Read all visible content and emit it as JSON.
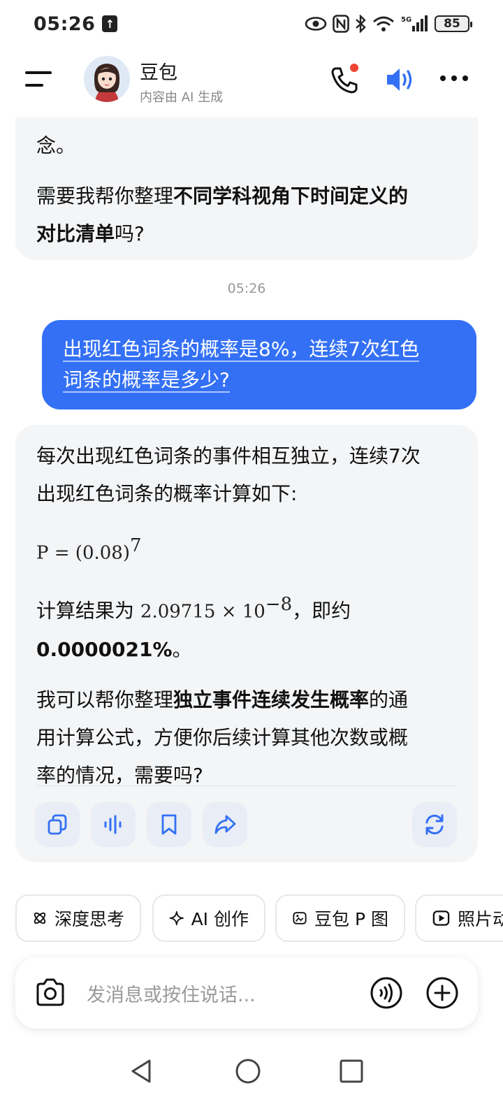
{
  "status": {
    "time": "05:26",
    "battery": "85",
    "network": "5G"
  },
  "header": {
    "name": "豆包",
    "subtitle": "内容由 AI 生成"
  },
  "chat": {
    "msg1_line1": "念。",
    "msg1_line2_pre": "需要我帮你整理",
    "msg1_line2_bold": "不同学科视角下时间定义的",
    "msg1_line3_bold": "对比清单",
    "msg1_line3_post": "吗?",
    "timestamp": "05:26",
    "user_line1": "出现红色词条的概率是8%，连续7次红色",
    "user_line2": "词条的概率是多少?",
    "ai_line1": "每次出现红色词条的事件相互独立，连续7次",
    "ai_line2": "出现红色词条的概率计算如下:",
    "ai_formula_base": "P = (0.08)",
    "ai_formula_exp": "7",
    "ai_result_pre": "计算结果为 ",
    "ai_result_math": "2.09715 × 10",
    "ai_result_exp": "−8",
    "ai_result_post": "，即约",
    "ai_result_pct": "0.0000021%",
    "ai_result_end": "。",
    "ai_offer_pre": "我可以帮你整理",
    "ai_offer_bold": "独立事件连续发生概率",
    "ai_offer_post1": "的通",
    "ai_offer_line2": "用计算公式，方便你后续计算其他次数或概",
    "ai_offer_line3": "率的情况，需要吗?"
  },
  "chips": [
    {
      "label": "深度思考",
      "icon": "atom-icon"
    },
    {
      "label": "AI 创作",
      "icon": "sparkle-icon"
    },
    {
      "label": "豆包 P 图",
      "icon": "image-edit-icon"
    },
    {
      "label": "照片动",
      "icon": "play-icon"
    }
  ],
  "input": {
    "placeholder": "发消息或按住说话..."
  },
  "colors": {
    "accent": "#3370f5",
    "bubble_bg": "#f4f5f7",
    "notification": "#ee4433"
  }
}
